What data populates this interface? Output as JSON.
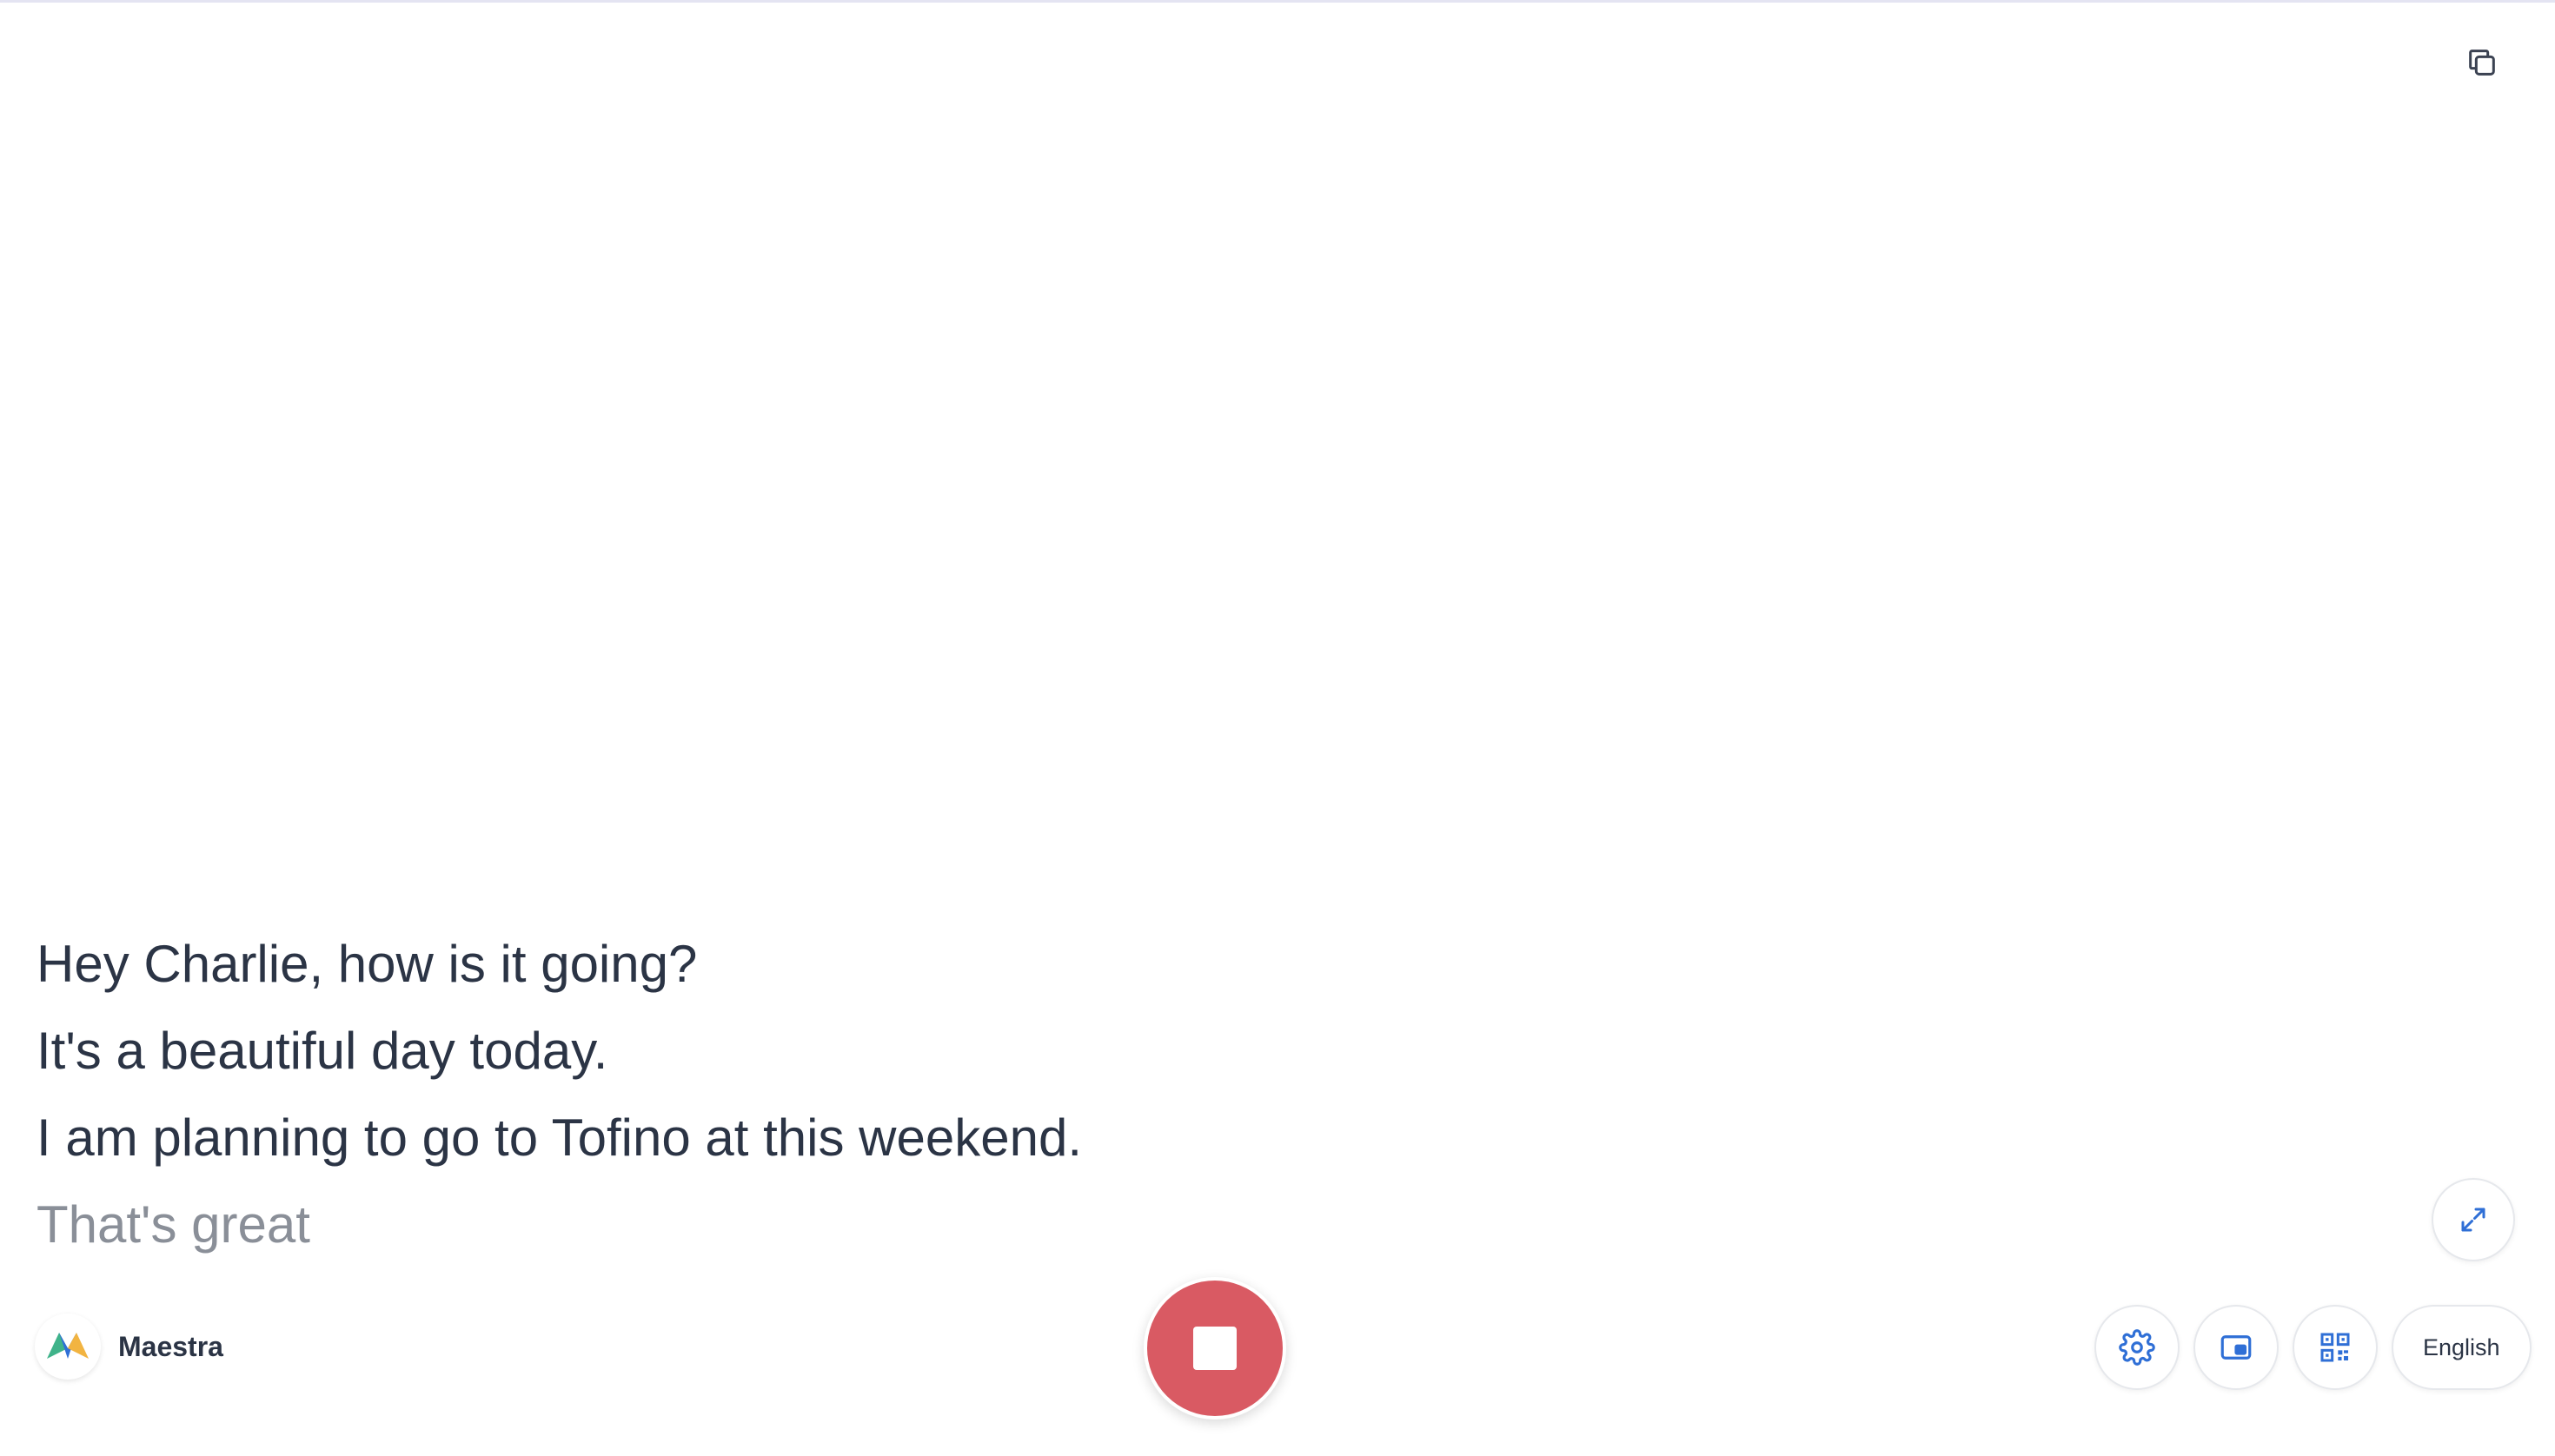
{
  "transcript": {
    "lines": [
      "Hey Charlie, how is it going?",
      "It's a beautiful day today.",
      "I am planning to go to Tofino at this weekend."
    ],
    "interim": "That's great"
  },
  "brand": {
    "name": "Maestra"
  },
  "toolbar": {
    "language_label": "English"
  },
  "icons": {
    "copy": "copy-icon",
    "expand": "expand-icon",
    "stop": "stop-icon",
    "settings": "gear-icon",
    "picture_in_picture": "picture-in-picture-icon",
    "qr": "qr-code-icon",
    "logo": "maestra-logo"
  },
  "colors": {
    "stop_button": "#d95a63",
    "icon_blue": "#2f6fd6",
    "text": "#2b3445",
    "interim_text": "#8a8f98"
  }
}
